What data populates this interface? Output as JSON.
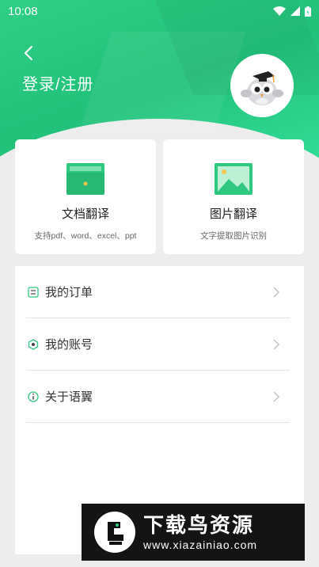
{
  "status_bar": {
    "time": "10:08"
  },
  "header": {
    "title": "登录/注册"
  },
  "cards": [
    {
      "title": "文档翻译",
      "subtitle": "支持pdf、word、excel、ppt",
      "icon": "document-folder-icon"
    },
    {
      "title": "图片翻译",
      "subtitle": "文字提取图片识别",
      "icon": "image-icon"
    }
  ],
  "menu": [
    {
      "label": "我的订单",
      "icon": "order-list-icon"
    },
    {
      "label": "我的账号",
      "icon": "account-hexagon-icon"
    },
    {
      "label": "关于语翼",
      "icon": "info-icon"
    }
  ],
  "watermark": {
    "brand": "下载鸟资源",
    "url": "www.xiazainiao.com"
  },
  "colors": {
    "accent": "#2fcf86",
    "background": "#ededed"
  }
}
